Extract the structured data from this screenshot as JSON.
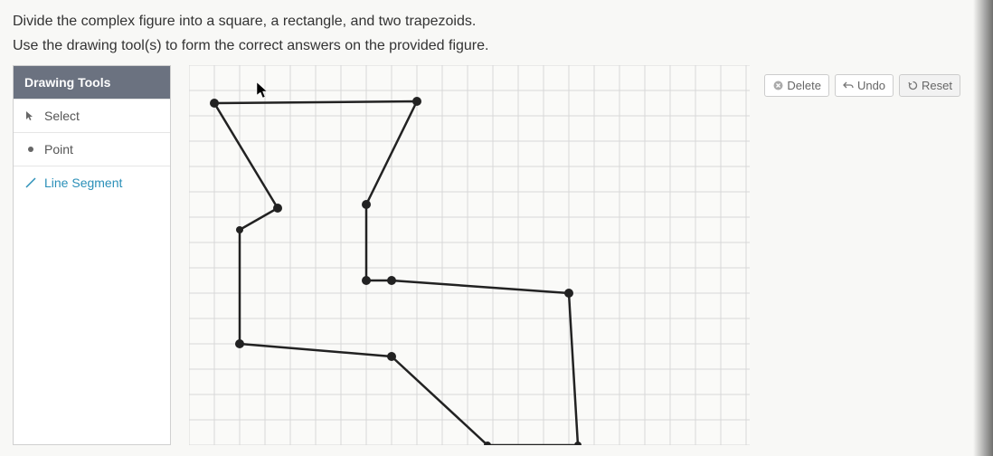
{
  "instructions": {
    "line1": "Divide the complex figure into a square, a rectangle, and two trapezoids.",
    "line2": "Use the drawing tool(s) to form the correct answers on the provided figure."
  },
  "toolsPanel": {
    "header": "Drawing Tools",
    "items": [
      {
        "label": "Select",
        "icon": "cursor-icon"
      },
      {
        "label": "Point",
        "icon": "dot-icon"
      },
      {
        "label": "Line Segment",
        "icon": "line-icon"
      }
    ]
  },
  "actions": {
    "delete": "Delete",
    "undo": "Undo",
    "reset": "Reset"
  }
}
